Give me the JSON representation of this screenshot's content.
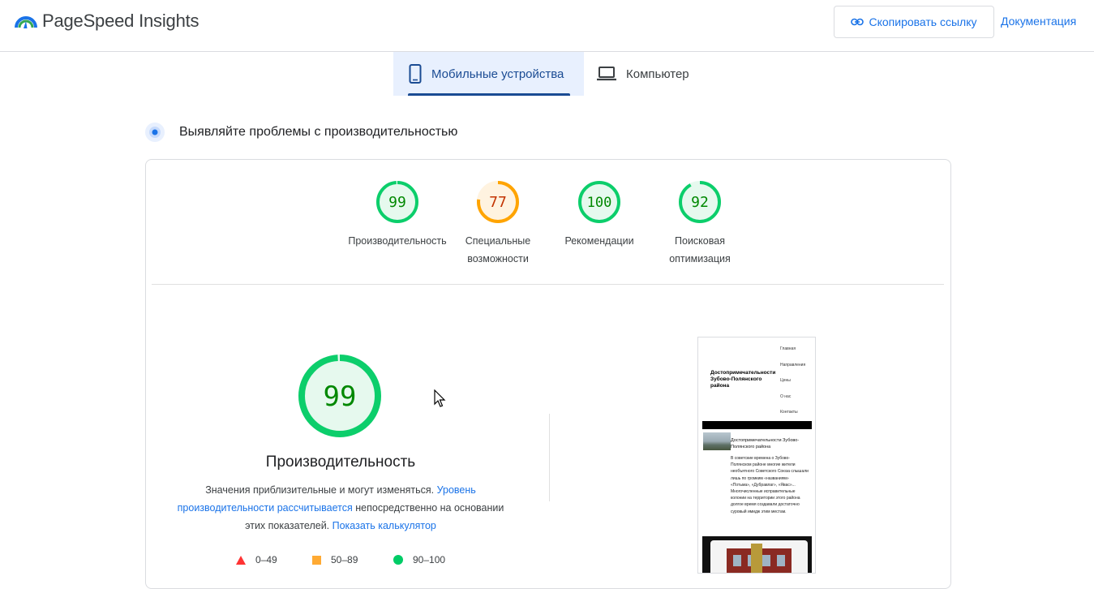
{
  "header": {
    "app_title": "PageSpeed Insights",
    "copy_link_label": "Скопировать ссылку",
    "docs_label": "Документация"
  },
  "tabs": [
    {
      "label": "Мобильные устройства",
      "active": true
    },
    {
      "label": "Компьютер",
      "active": false
    }
  ],
  "section": {
    "heading": "Выявляйте проблемы с производительностью"
  },
  "categories": [
    {
      "score": "99",
      "value": 99,
      "label": "Производительность",
      "status": "pass"
    },
    {
      "score": "77",
      "value": 77,
      "label": "Специальные возможности",
      "status": "average"
    },
    {
      "score": "100",
      "value": 100,
      "label": "Рекомендации",
      "status": "pass"
    },
    {
      "score": "92",
      "value": 92,
      "label": "Поисковая оптимизация",
      "status": "pass"
    }
  ],
  "performance": {
    "score": "99",
    "value": 99,
    "title": "Производительность",
    "desc_part1": "Значения приблизительные и могут изменяться. ",
    "desc_link1": "Уровень производительности рассчитывается",
    "desc_part2": " непосредственно на основании этих показателей. ",
    "desc_link2": "Показать калькулятор"
  },
  "legend": [
    {
      "shape": "triangle",
      "color": "#f33",
      "label": "0–49"
    },
    {
      "shape": "square",
      "color": "#fa3",
      "label": "50–89"
    },
    {
      "shape": "circle",
      "color": "#0c6",
      "label": "90–100"
    }
  ],
  "colors": {
    "pass": "#0cce6b",
    "pass_text": "#008800",
    "pass_bg": "#e6f9ee",
    "average": "#ffa400",
    "average_text": "#c33300",
    "average_bg": "#fff3e0",
    "accent": "#1a73e8"
  },
  "screenshot": {
    "site_title": "Достопримечательности Зубово-Полянского района",
    "nav": [
      "Главная",
      "Направления",
      "Цены",
      "О нас",
      "Контакты"
    ],
    "article_title": "Достопримечательности Зубово-Полянского района",
    "article_text": "В советские времена о Зубово-Полянском районе многие жители необъятного Советского Союза слышали лишь по громким «названиям» «Потьма», «Дубравлаг», «Явас»... Многочисленные исправительные колонии на территории этого района долгое время создавали достаточно суровый имидж этим местам."
  }
}
